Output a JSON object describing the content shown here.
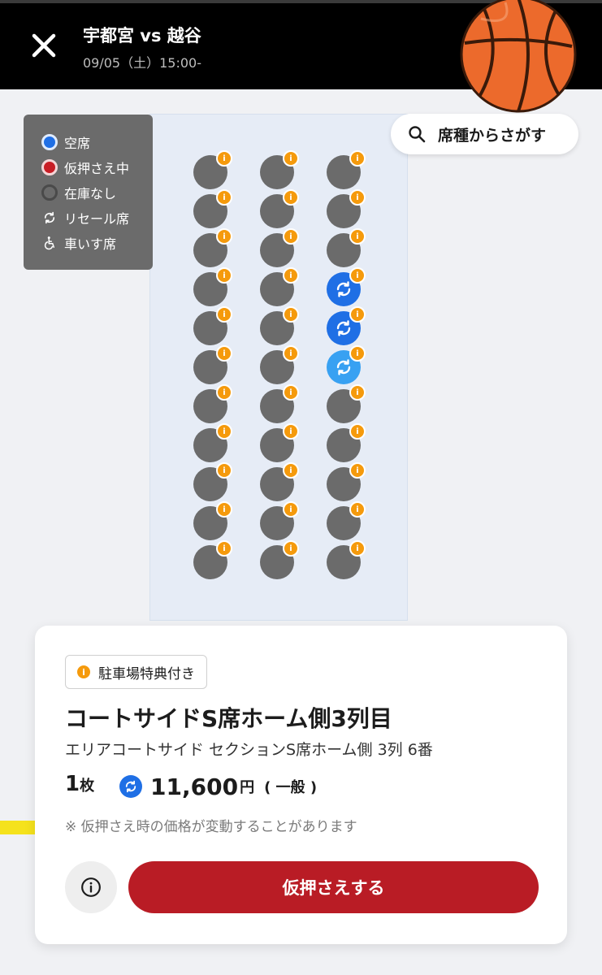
{
  "header": {
    "title": "宇都宮 vs 越谷",
    "datetime": "09/05（土）15:00-"
  },
  "legend": {
    "items": [
      {
        "label": "空席",
        "icon": "available-dot-icon",
        "color": "#1f6fe5"
      },
      {
        "label": "仮押さえ中",
        "icon": "on-hold-dot-icon",
        "color": "#c81d25"
      },
      {
        "label": "在庫なし",
        "icon": "sold-out-dot-icon",
        "color": "#6b6b6b"
      },
      {
        "label": "リセール席",
        "icon": "resale-icon"
      },
      {
        "label": "車いす席",
        "icon": "wheelchair-icon"
      }
    ]
  },
  "search": {
    "label": "席種からさがす"
  },
  "seat_map": {
    "columns": 3,
    "rows": 11,
    "resale_seats": [
      {
        "col": 3,
        "row": 4,
        "shade": "dark"
      },
      {
        "col": 3,
        "row": 5,
        "shade": "dark"
      },
      {
        "col": 3,
        "row": 6,
        "shade": "light"
      }
    ],
    "colors": {
      "sold_out": "#6b6b6b",
      "resale": "#1f6fe5",
      "resale_selected": "#38a1f2",
      "info_badge": "#f59a0c"
    }
  },
  "detail_card": {
    "perk_badge": "駐車場特典付き",
    "seat_name": "コートサイドS席ホーム側3列目",
    "seat_detail": "エリアコートサイド セクションS席ホーム側 3列 6番",
    "quantity": "1",
    "quantity_unit": "枚",
    "price": "11,600",
    "price_unit": "円",
    "price_type": "( 一般 )",
    "note": "※ 仮押さえ時の価格が変動することがあります",
    "hold_button": "仮押さえする"
  },
  "colors": {
    "accent_red": "#b91c25",
    "header_bg": "#000000"
  }
}
